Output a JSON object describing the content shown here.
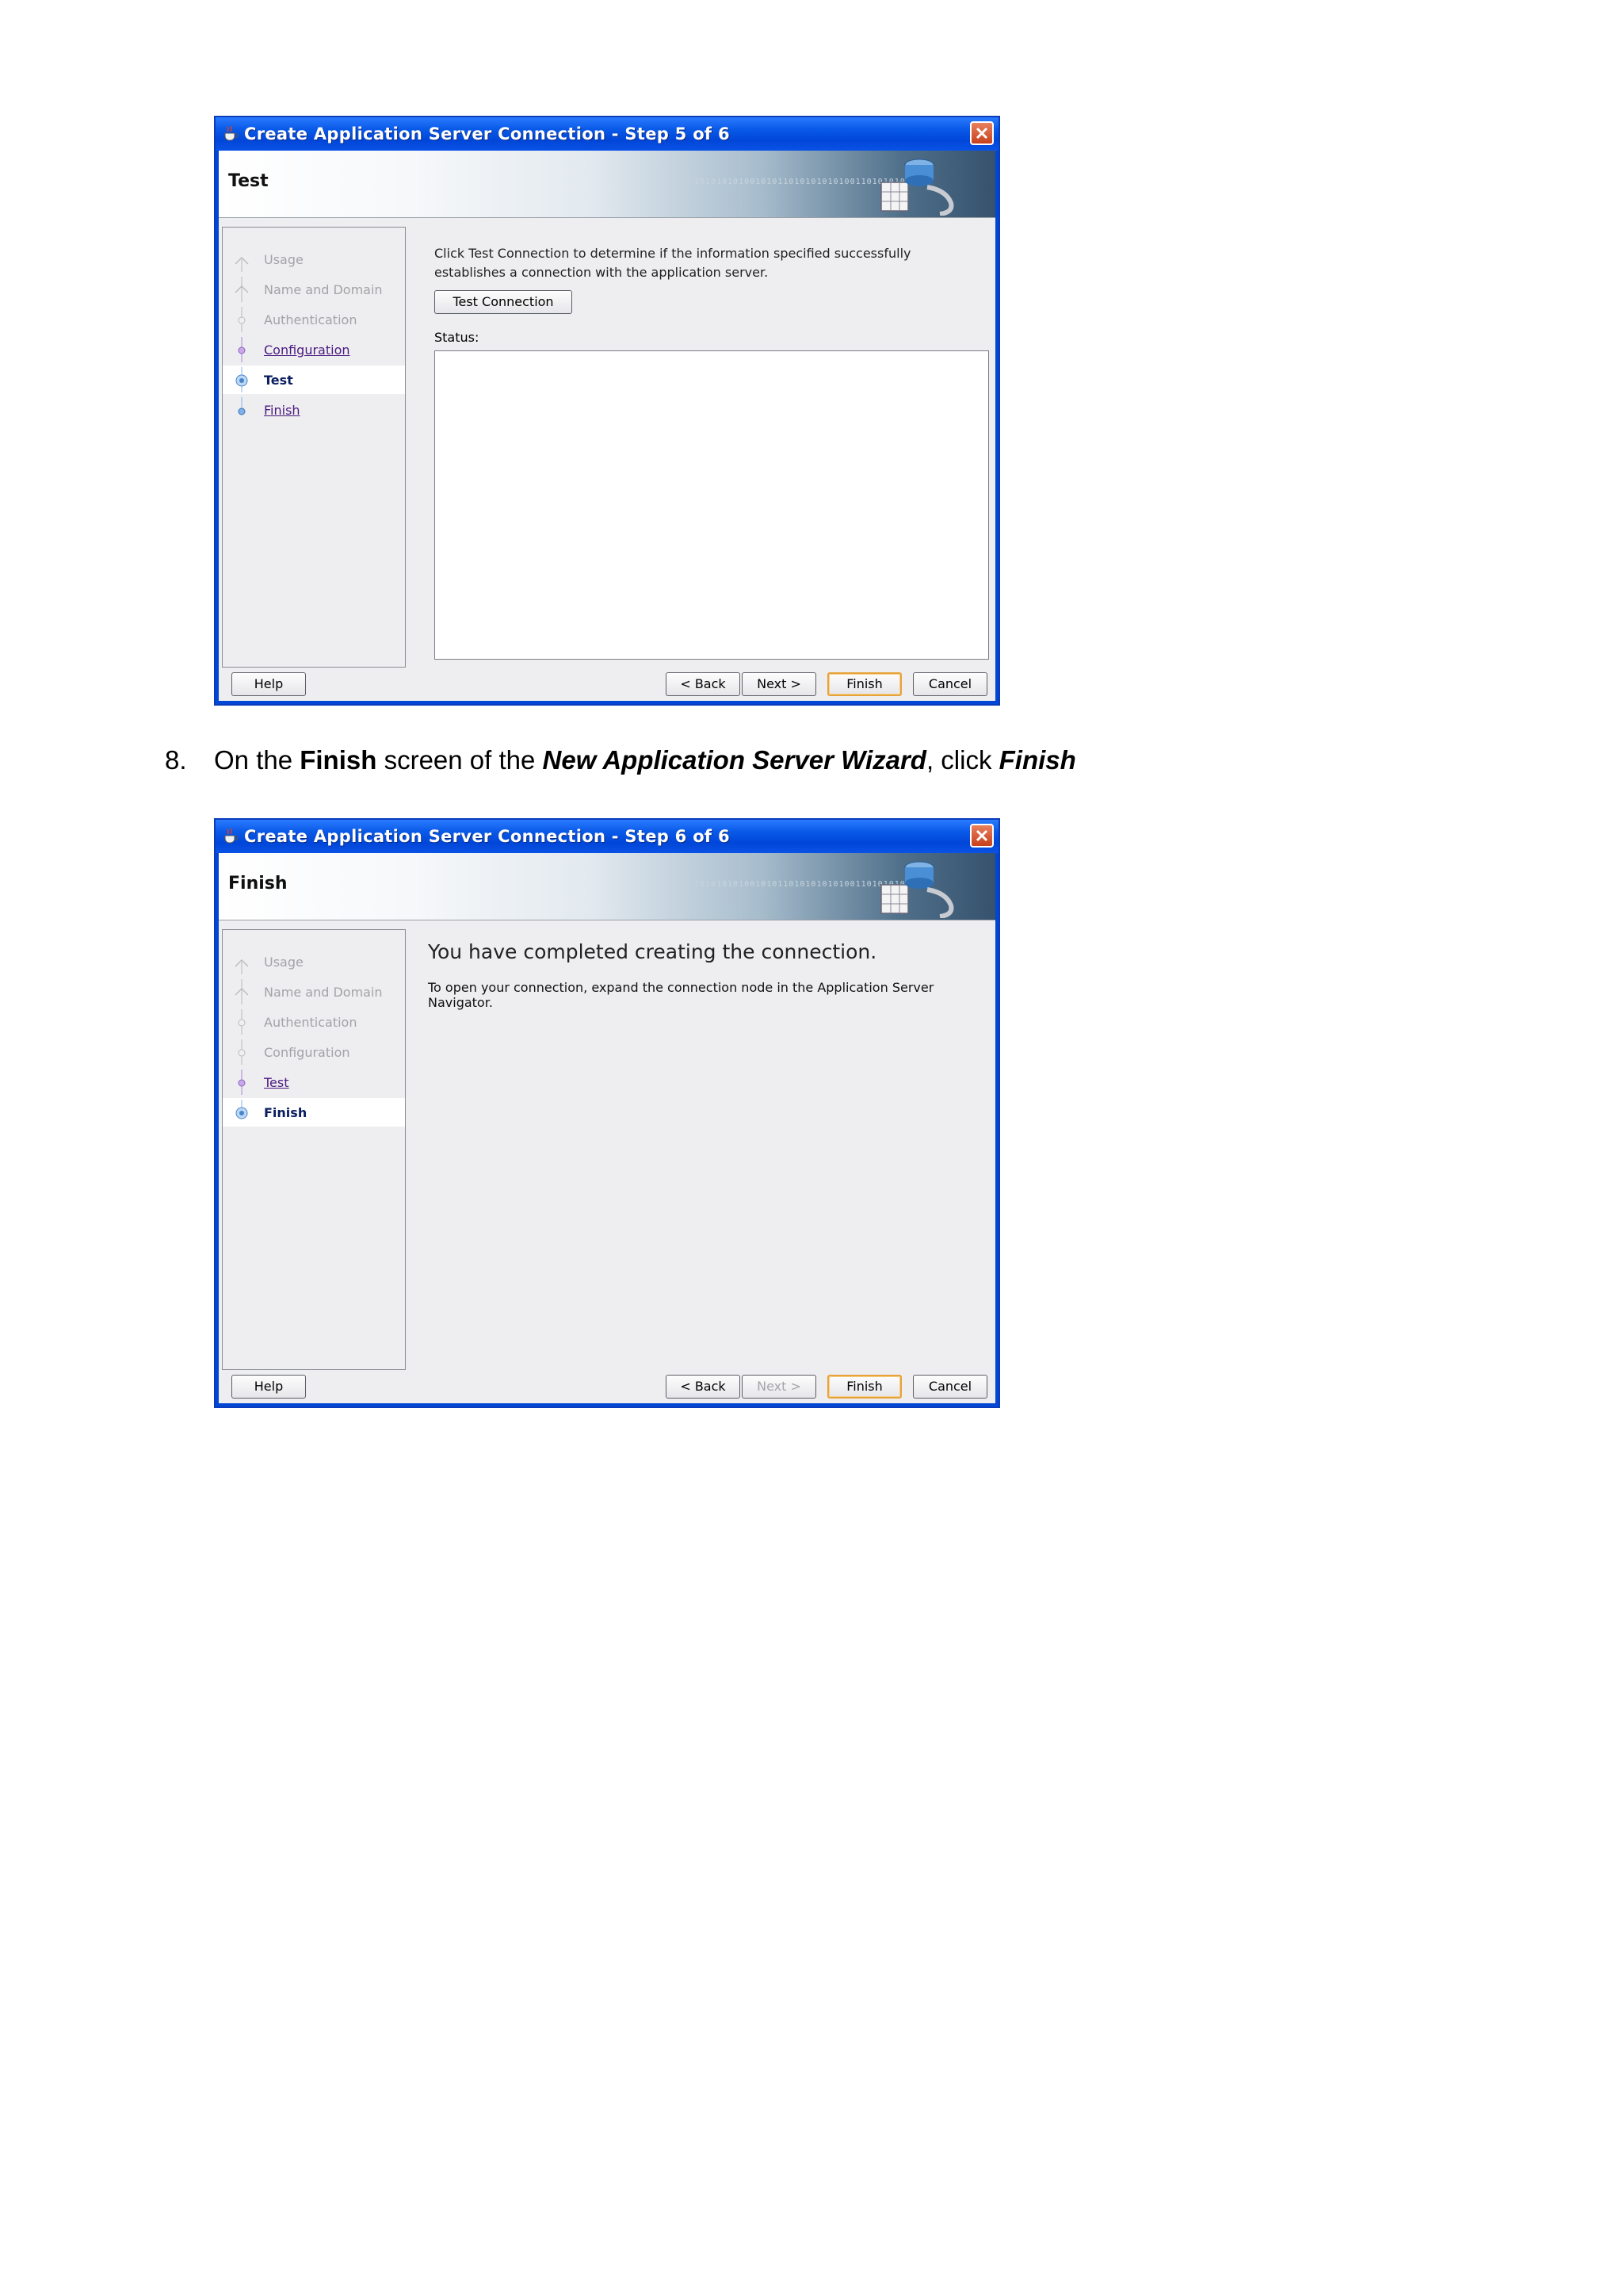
{
  "dialogs": [
    {
      "title": "Create Application Server Connection - Step 5 of 6",
      "header_title": "Test",
      "binary_text": "10101010100101011010101010100110101010",
      "nav": [
        {
          "label": "Usage",
          "state": "disabled"
        },
        {
          "label": "Name and Domain",
          "state": "disabled"
        },
        {
          "label": "Authentication",
          "state": "disabled"
        },
        {
          "label": "Configuration",
          "state": "link"
        },
        {
          "label": "Test",
          "state": "current"
        },
        {
          "label": "Finish",
          "state": "link"
        }
      ],
      "description": "Click Test Connection to determine if the information specified successfully establishes a connection with the application server.",
      "test_button": "Test Connection",
      "status_label": "Status:",
      "buttons": {
        "help": "Help",
        "back": "< Back",
        "next": "Next >",
        "finish": "Finish",
        "cancel": "Cancel"
      },
      "next_enabled": true
    },
    {
      "title": "Create Application Server Connection - Step 6 of 6",
      "header_title": "Finish",
      "binary_text": "10101010100101011010101010100110101010",
      "nav": [
        {
          "label": "Usage",
          "state": "disabled"
        },
        {
          "label": "Name and Domain",
          "state": "disabled"
        },
        {
          "label": "Authentication",
          "state": "disabled"
        },
        {
          "label": "Configuration",
          "state": "disabled"
        },
        {
          "label": "Test",
          "state": "link"
        },
        {
          "label": "Finish",
          "state": "current"
        }
      ],
      "message": "You have completed creating the connection.",
      "sub_message": "To open your connection, expand the connection node in the Application Server Navigator.",
      "buttons": {
        "help": "Help",
        "back": "< Back",
        "next": "Next >",
        "finish": "Finish",
        "cancel": "Cancel"
      },
      "next_enabled": false
    }
  ],
  "instruction": {
    "number": "8.",
    "parts": [
      {
        "text": "On the ",
        "style": "normal"
      },
      {
        "text": "Finish",
        "style": "bold"
      },
      {
        "text": " screen of the ",
        "style": "normal"
      },
      {
        "text": "New Application Server Wizard",
        "style": "bold-italic"
      },
      {
        "text": ", click ",
        "style": "normal"
      },
      {
        "text": "Finish",
        "style": "bold-italic"
      }
    ]
  },
  "colors": {
    "titlebar": "#0a5ae8",
    "dialog_bg": "#eeedef",
    "link": "#4a1a80",
    "current_step": "#0a1d60",
    "disabled_text": "#a3a3a8",
    "default_button_border": "#e8a23a",
    "close_button": "#d85a34"
  },
  "icons": {
    "title": "coffee-cup-icon",
    "close": "close-icon",
    "header_decor": "database-server-icon"
  }
}
